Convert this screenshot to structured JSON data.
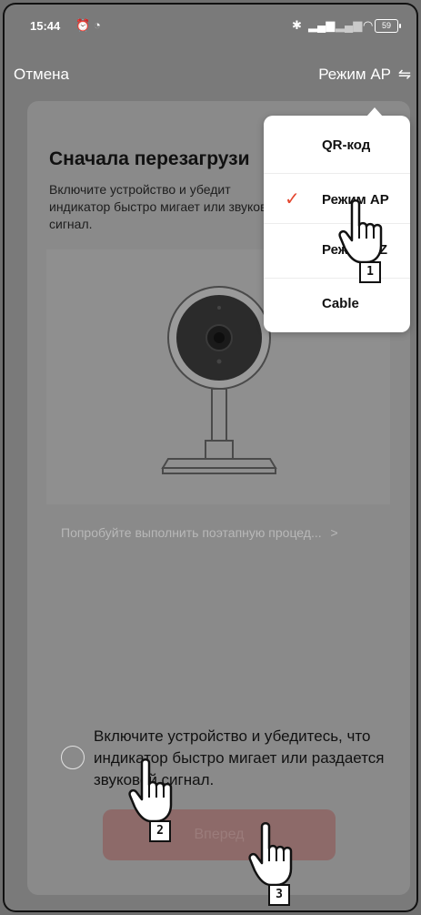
{
  "status_bar": {
    "time": "15:44",
    "alarm_icon": "alarm-icon",
    "sync_icon": "sync-icon",
    "bluetooth_icon": "bluetooth-icon",
    "signal_icon": "signal-icon",
    "wifi_icon": "wifi-icon",
    "battery": "59"
  },
  "top_bar": {
    "cancel": "Отмена",
    "mode": "Режим AP",
    "swap_icon": "⇋"
  },
  "card": {
    "heading": "Сначала перезагрузи",
    "description": "Включите устройство и убедит индикатор быстро мигает или звуковой сигнал.",
    "troubleshoot_link": "Попробуйте выполнить поэтапную процед...",
    "link_arrow": ">",
    "consent_text": "Включите устройство и убедитесь, что индикатор быстро мигает или раздается звуковой сигнал.",
    "next_button": "Вперед"
  },
  "dropdown": {
    "options": [
      {
        "label": "QR-код",
        "selected": false
      },
      {
        "label": "Режим AP",
        "selected": true
      },
      {
        "label": "Режим EZ",
        "selected": false
      },
      {
        "label": "Cable",
        "selected": false
      }
    ],
    "check_mark": "✓"
  },
  "annotations": {
    "step1": "1",
    "step2": "2",
    "step3": "3"
  },
  "colors": {
    "accent": "#e4472f",
    "button_disabled": "#8d6a69",
    "overlay": "#7a7a7a"
  }
}
